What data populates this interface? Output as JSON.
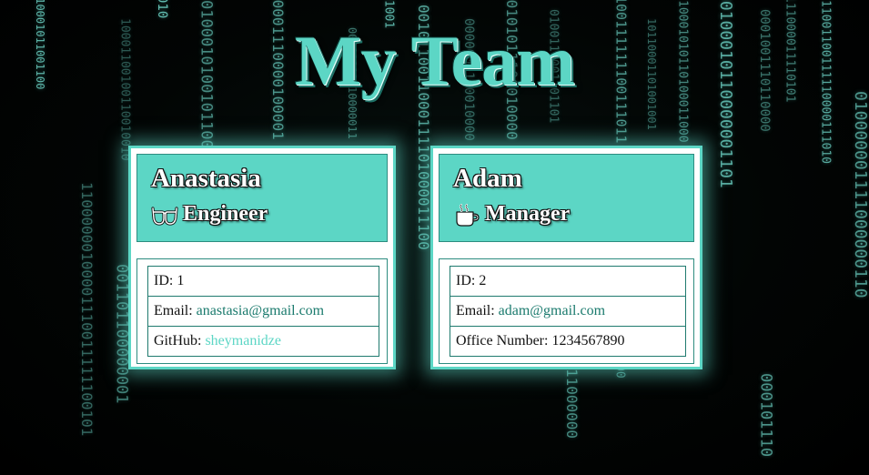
{
  "page": {
    "title": "My Team"
  },
  "colors": {
    "accent": "#5cd6c5",
    "accent_dark": "#1f7a6e",
    "background": "#000000",
    "card_bg": "#ffffff"
  },
  "employees": [
    {
      "name": "Anastasia",
      "role": "Engineer",
      "role_icon": "glasses-icon",
      "id_label": "ID:",
      "id_value": "1",
      "email_label": "Email:",
      "email_value": "anastasia@gmail.com",
      "extra_label": "GitHub:",
      "extra_value": "sheymanidze"
    },
    {
      "name": "Adam",
      "role": "Manager",
      "role_icon": "coffee-mug-icon",
      "id_label": "ID:",
      "id_value": "2",
      "email_label": "Email:",
      "email_value": "adam@gmail.com",
      "extra_label": "Office Number:",
      "extra_value": "1234567890"
    }
  ]
}
